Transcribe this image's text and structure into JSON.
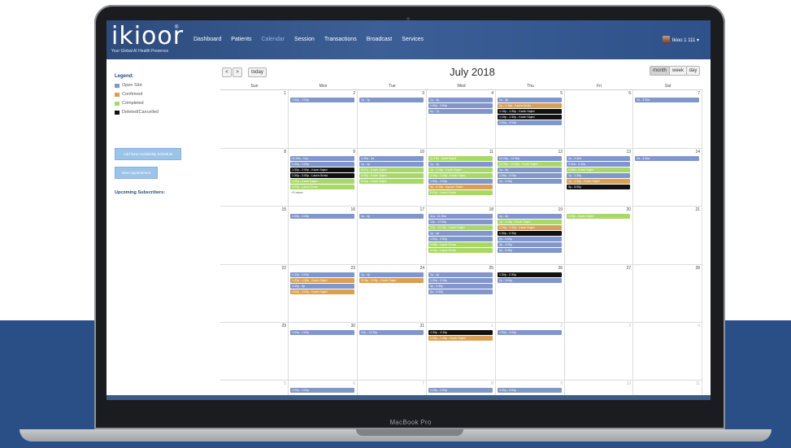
{
  "colors": {
    "open": "#8197cc",
    "confirmed": "#d9a054",
    "completed": "#a8d968",
    "deleted": "#111111"
  },
  "device": {
    "label": "MacBook Pro"
  },
  "header": {
    "logo": "ikioor",
    "logo_mark": "®",
    "tagline": "Your Global AI Health Presence",
    "nav": [
      "Dashboard",
      "Patients",
      "Calendar",
      "Session",
      "Transactions",
      "Broadcast",
      "Services"
    ],
    "active_nav": "Calendar",
    "user": "Ikioo 1 111 ▾"
  },
  "sidebar": {
    "legend_title": "Legend:",
    "legend": [
      {
        "label": "Open Slot",
        "color": "#8197cc"
      },
      {
        "label": "Confirmed",
        "color": "#d9a054"
      },
      {
        "label": "Completed",
        "color": "#a8d968"
      },
      {
        "label": "Deleted/Cancelled",
        "color": "#111111"
      }
    ],
    "add_availability": "Add New Availability Schedule",
    "new_appointment": "New Appointment",
    "upcoming_title": "Upcoming Subscribers:"
  },
  "toolbar": {
    "prev": "<",
    "next": ">",
    "today": "today",
    "title": "July 2018",
    "views": [
      "month",
      "week",
      "day"
    ],
    "active_view": "month"
  },
  "days_of_week": [
    "Sun",
    "Mon",
    "Tue",
    "Wed",
    "Thu",
    "Fri",
    "Sat"
  ],
  "weeks": [
    {
      "days": [
        {
          "num": "1",
          "events": []
        },
        {
          "num": "2",
          "events": [
            {
              "t": "1:00p - 2:00p",
              "c": "open"
            }
          ]
        },
        {
          "num": "3",
          "events": [
            {
              "t": "1p - 4p",
              "c": "open"
            }
          ]
        },
        {
          "num": "4",
          "events": [
            {
              "t": "1p - 4p",
              "c": "open"
            },
            {
              "t": "1:00p - 2:00p",
              "c": "open"
            },
            {
              "t": "5p - 7p",
              "c": "open"
            }
          ]
        },
        {
          "num": "5",
          "events": [
            {
              "t": "1p - 4p",
              "c": "open"
            },
            {
              "t": "1p - 1:15p - Laura Gross",
              "c": "confirmed"
            },
            {
              "t": "1:15p - 1:30p - Kavin Sajed",
              "c": "deleted"
            },
            {
              "t": "1:15p - 1:30p - Kavin Sajed",
              "c": "deleted"
            },
            {
              "t": "1:00p - 2:00p",
              "c": "open"
            }
          ]
        },
        {
          "num": "6",
          "events": []
        },
        {
          "num": "7",
          "events": [
            {
              "t": "2a - 3:00a",
              "c": "open"
            }
          ]
        }
      ]
    },
    {
      "more": "+3 more",
      "days": [
        {
          "num": "8",
          "events": []
        },
        {
          "num": "9",
          "events": [
            {
              "t": "11:00a - 12p",
              "c": "open"
            },
            {
              "t": "1:00p - 2:00p",
              "c": "open"
            },
            {
              "t": "1:30p - 2:00p - Kavin Sajed",
              "c": "deleted"
            },
            {
              "t": "1:30p - 2:00p - Laura Gross",
              "c": "deleted"
            },
            {
              "t": "2:00p - Kavin Sajed",
              "c": "completed"
            },
            {
              "t": "3:00p - Laura Gross",
              "c": "completed"
            }
          ]
        },
        {
          "num": "10",
          "events": [
            {
              "t": "1:30a - 2a",
              "c": "open"
            },
            {
              "t": "1p - 4p",
              "c": "open"
            },
            {
              "t": "4:07p - Kavin Sajed",
              "c": "completed"
            },
            {
              "t": "4:30p - Kavin Sajed",
              "c": "completed"
            },
            {
              "t": "5:00p - Kavin Sajed",
              "c": "completed"
            }
          ]
        },
        {
          "num": "11",
          "events": [
            {
              "t": "11:15a - Sahil Sajed",
              "c": "completed"
            },
            {
              "t": "1p - 4p",
              "c": "open"
            },
            {
              "t": "1p - 1:15p - Kavin Sajed",
              "c": "completed"
            },
            {
              "t": "1:15p - 1:30p - Kavin Sajed",
              "c": "completed"
            },
            {
              "t": "1:00p - 2:00p",
              "c": "open"
            },
            {
              "t": "5p - 6:15p - Ayman Saleh",
              "c": "confirmed"
            },
            {
              "t": "6:00p - Laura Gross",
              "c": "completed"
            }
          ]
        },
        {
          "num": "12",
          "events": [
            {
              "t": "12:15p - 12:30p",
              "c": "open"
            },
            {
              "t": "12:30p - 12:45p - Kavin Sajed",
              "c": "completed"
            },
            {
              "t": "1p - 4p",
              "c": "open"
            },
            {
              "t": "1:30p - 2:00p",
              "c": "open"
            },
            {
              "t": "2p - 3:00p",
              "c": "open"
            }
          ]
        },
        {
          "num": "13",
          "events": [
            {
              "t": "2a - 2:30a",
              "c": "open"
            },
            {
              "t": "9:30a - 9:45a",
              "c": "open"
            },
            {
              "t": "9:45a - Kavin Sajed",
              "c": "completed"
            },
            {
              "t": "1p - 1:30p",
              "c": "open"
            },
            {
              "t": "1p - 1:30p - Kavin Sajed",
              "c": "confirmed"
            },
            {
              "t": "5p - 6:00p",
              "c": "deleted"
            }
          ]
        },
        {
          "num": "14",
          "events": [
            {
              "t": "2a - 3:30a",
              "c": "open"
            }
          ]
        }
      ]
    },
    {
      "days": [
        {
          "num": "15",
          "events": []
        },
        {
          "num": "16",
          "events": [
            {
              "t": "1:00p - 2:00p",
              "c": "open"
            }
          ]
        },
        {
          "num": "17",
          "events": [
            {
              "t": "1p - 4p",
              "c": "open"
            }
          ]
        },
        {
          "num": "18",
          "events": [
            {
              "t": "11a - 11:30a",
              "c": "open"
            },
            {
              "t": "12p - 12:30p",
              "c": "open"
            },
            {
              "t": "12p - 12:15p - Kavin Sajed",
              "c": "completed"
            },
            {
              "t": "1p - 4p",
              "c": "open"
            },
            {
              "t": "1:00p - 2:00p",
              "c": "open"
            },
            {
              "t": "3:00p - Laura Gross",
              "c": "completed"
            },
            {
              "t": "4:00p - Laura Gross",
              "c": "completed"
            }
          ]
        },
        {
          "num": "19",
          "events": [
            {
              "t": "1p - 4p",
              "c": "open"
            },
            {
              "t": "1p - 1:15p - Kavin Sajed",
              "c": "completed"
            },
            {
              "t": "1:15p - 1:30p - Kavin Sajed",
              "c": "confirmed"
            },
            {
              "t": "1:30p - 2:30p",
              "c": "deleted"
            },
            {
              "t": "2p - 3:00p",
              "c": "open"
            },
            {
              "t": "3p - 4:00p",
              "c": "open"
            },
            {
              "t": "5p - 5:30p",
              "c": "open"
            }
          ]
        },
        {
          "num": "20",
          "events": [
            {
              "t": "1:00p - Kavin Sajed",
              "c": "completed"
            }
          ]
        },
        {
          "num": "21",
          "events": []
        }
      ]
    },
    {
      "days": [
        {
          "num": "22",
          "events": []
        },
        {
          "num": "23",
          "events": [
            {
              "t": "1:30p - 2:00p",
              "c": "open"
            },
            {
              "t": "1:00p - 1:45p - Kavin Sajed",
              "c": "confirmed"
            },
            {
              "t": "4:30p - 5p",
              "c": "open"
            },
            {
              "t": "4:00p - 4:45p - Kavin Sajed",
              "c": "confirmed"
            }
          ]
        },
        {
          "num": "24",
          "events": [
            {
              "t": "1p - 4p",
              "c": "open"
            },
            {
              "t": "3:15p - 3:30p - Kavin Sajed",
              "c": "confirmed"
            }
          ]
        },
        {
          "num": "25",
          "events": [
            {
              "t": "1p - 4p",
              "c": "open"
            },
            {
              "t": "1:00p - 2:30p",
              "c": "open"
            },
            {
              "t": "3p - 3:30p",
              "c": "open"
            },
            {
              "t": "5p - 5:30p",
              "c": "open"
            }
          ]
        },
        {
          "num": "26",
          "events": [
            {
              "t": "1:30p - 2:30p",
              "c": "deleted"
            },
            {
              "t": "2p - 3:00p",
              "c": "open"
            }
          ]
        },
        {
          "num": "27",
          "events": []
        },
        {
          "num": "28",
          "events": []
        }
      ]
    },
    {
      "days": [
        {
          "num": "29",
          "events": []
        },
        {
          "num": "30",
          "events": [
            {
              "t": "1:00p - 2:00p",
              "c": "open"
            }
          ]
        },
        {
          "num": "31",
          "events": [
            {
              "t": "12p - 12:30p",
              "c": "open"
            }
          ]
        },
        {
          "num": "1",
          "other": true,
          "events": [
            {
              "t": "1:30p - 2:30p",
              "c": "deleted"
            },
            {
              "t": "1:00p - 1:45p - Kavin Sajed",
              "c": "confirmed"
            }
          ]
        },
        {
          "num": "2",
          "other": true,
          "events": [
            {
              "t": "1:00p - 2:00p",
              "c": "open"
            }
          ]
        },
        {
          "num": "3",
          "other": true,
          "events": []
        },
        {
          "num": "4",
          "other": true,
          "events": []
        }
      ]
    },
    {
      "days": [
        {
          "num": "5",
          "other": true,
          "events": []
        },
        {
          "num": "6",
          "other": true,
          "events": [
            {
              "t": "1:00p - 2:00p",
              "c": "open"
            }
          ]
        },
        {
          "num": "7",
          "other": true,
          "events": []
        },
        {
          "num": "8",
          "other": true,
          "events": [
            {
              "t": "1:00p - 2:00p",
              "c": "open"
            }
          ]
        },
        {
          "num": "9",
          "other": true,
          "events": [
            {
              "t": "1:00p - 2:00p",
              "c": "open"
            }
          ]
        },
        {
          "num": "10",
          "other": true,
          "events": []
        },
        {
          "num": "11",
          "other": true,
          "events": []
        }
      ]
    }
  ]
}
